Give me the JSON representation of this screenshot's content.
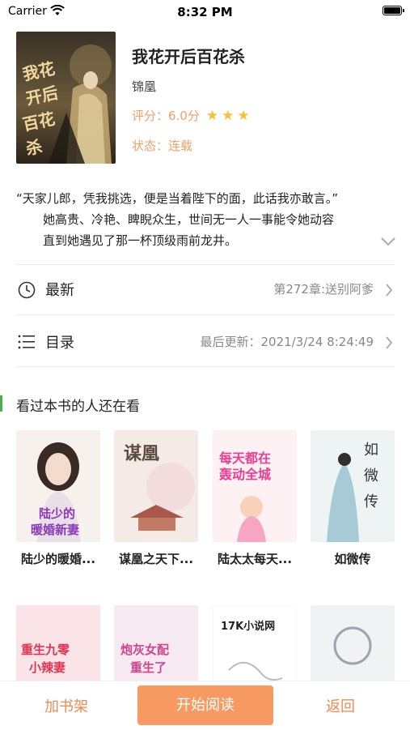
{
  "status_bar": {
    "carrier": "Carrier",
    "time": "8:32 PM"
  },
  "book": {
    "title": "我花开后百花杀",
    "author": "锦凰",
    "rating_label": "评分：6.0分",
    "rating_stars": "★★★",
    "status_label": "状态：连载",
    "cover_art_text": "我花开后百花杀"
  },
  "intro": {
    "line1": "“天家儿郎，凭我挑选，便是当着陛下的面，此话我亦敢言。”",
    "line2": "她高贵、冷艳、睥睨众生，世间无一人一事能令她动容",
    "line3": "直到她遇见了那一杯顶级雨前龙井。"
  },
  "rows": {
    "latest_label": "最新",
    "latest_value": "第272章:送别阿爹",
    "catalog_label": "目录",
    "catalog_value": "最后更新：2021/3/24 8:24:49"
  },
  "recommend": {
    "title": "看过本书的人还在看",
    "books": [
      {
        "name": "陆少的暖婚...",
        "cover_text": "陆少的暖婚新妻"
      },
      {
        "name": "谋凰之天下...",
        "cover_text": "谋凰"
      },
      {
        "name": "陆太太每天...",
        "cover_text": "每天都在轰动全城"
      },
      {
        "name": "如微传",
        "cover_text": "如微传"
      },
      {
        "name": "",
        "cover_text": "重生九零小辣妻"
      },
      {
        "name": "",
        "cover_text": "炮灰女配重生了"
      },
      {
        "name": "",
        "cover_text": "17K小说网"
      },
      {
        "name": "",
        "cover_text": ""
      }
    ]
  },
  "bottom_bar": {
    "add_label": "加书架",
    "read_label": "开始阅读",
    "back_label": "返回"
  },
  "colors": {
    "accent": "#f79a62",
    "accent_text": "#f08a50",
    "star": "#f5c231",
    "section_bar": "#4caf50"
  }
}
